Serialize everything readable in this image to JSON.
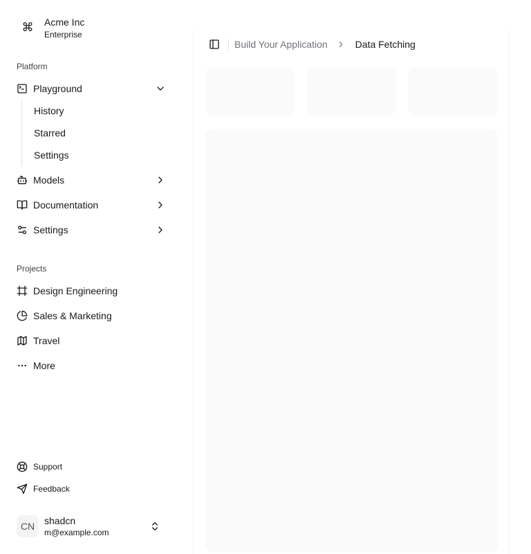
{
  "team": {
    "name": "Acme Inc",
    "plan": "Enterprise",
    "logo_icon": "command-icon"
  },
  "platform": {
    "label": "Platform",
    "playground": {
      "label": "Playground",
      "icon": "terminal-icon",
      "expanded": true
    },
    "sub_items": [
      {
        "label": "History"
      },
      {
        "label": "Starred"
      },
      {
        "label": "Settings"
      }
    ],
    "items": [
      {
        "label": "Models",
        "icon": "bot-icon"
      },
      {
        "label": "Documentation",
        "icon": "book-open-icon"
      },
      {
        "label": "Settings",
        "icon": "settings-sliders-icon"
      }
    ]
  },
  "projects": {
    "label": "Projects",
    "items": [
      {
        "label": "Design Engineering",
        "icon": "frame-icon"
      },
      {
        "label": "Sales & Marketing",
        "icon": "pie-chart-icon"
      },
      {
        "label": "Travel",
        "icon": "map-icon"
      },
      {
        "label": "More",
        "icon": "more-horizontal-icon"
      }
    ]
  },
  "footer": {
    "support": "Support",
    "feedback": "Feedback"
  },
  "user": {
    "initials": "CN",
    "name": "shadcn",
    "email": "m@example.com"
  },
  "breadcrumb": {
    "parent": "Build Your Application",
    "current": "Data Fetching"
  },
  "colors": {
    "text": "#18181b",
    "muted": "#71717a",
    "skeleton": "#fafafa",
    "border": "#e4e4e7"
  }
}
